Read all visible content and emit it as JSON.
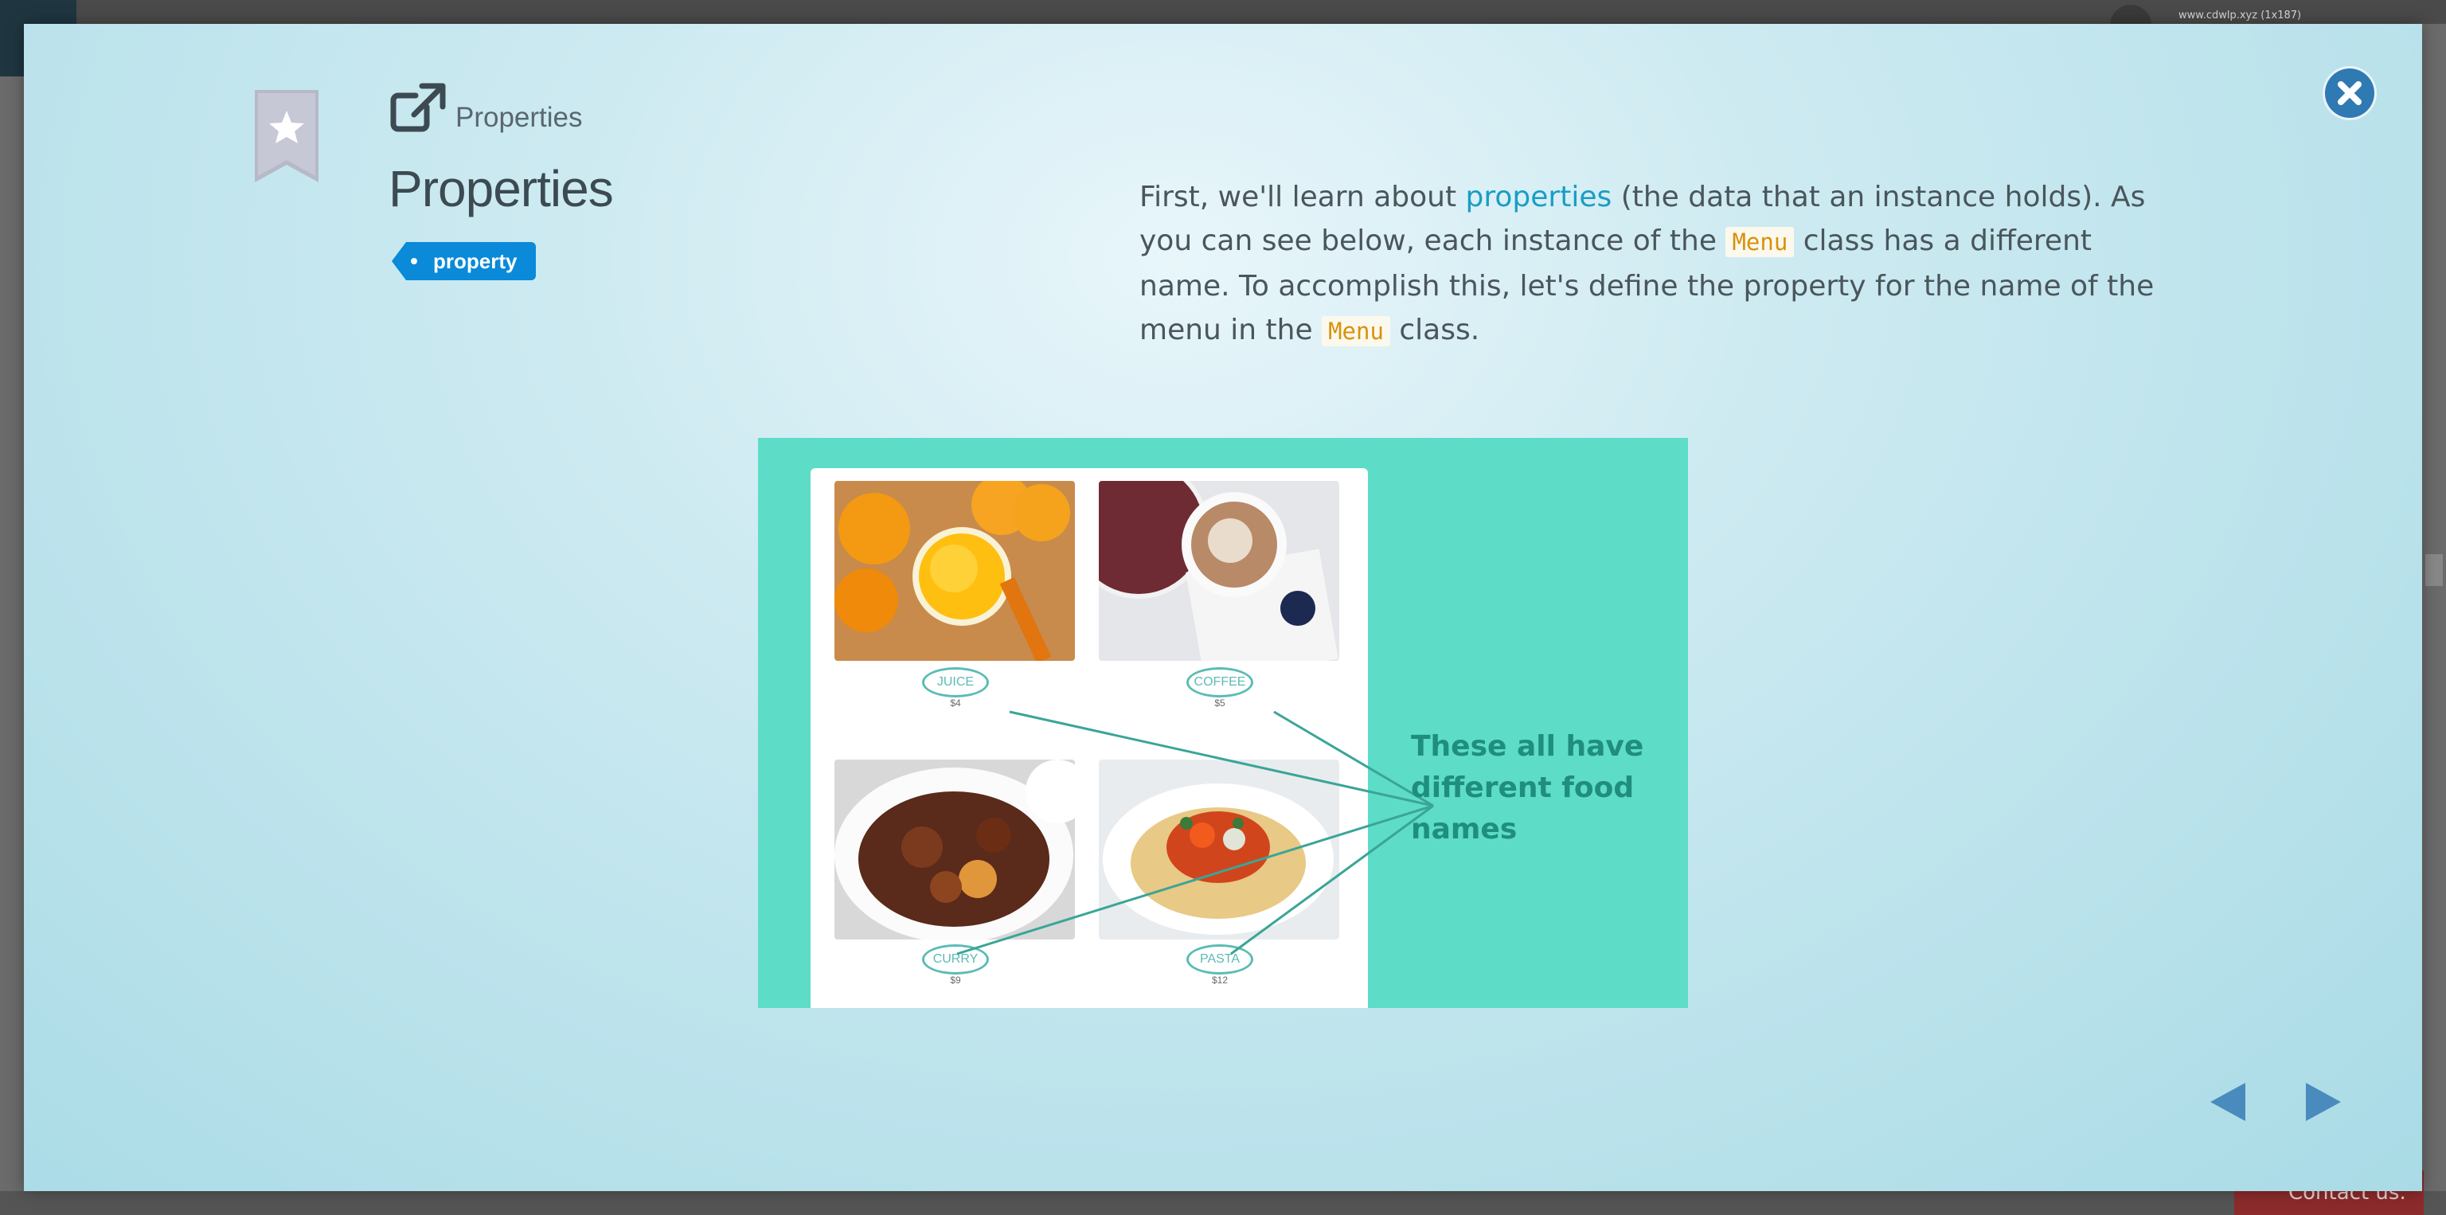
{
  "background": {
    "address_text": "www.cdwlp.xyz (1x187)",
    "contact_label": "Contact us."
  },
  "header": {
    "small_title": "Properties",
    "title": "Properties",
    "tag": "property"
  },
  "paragraph": {
    "part1": "First, we'll learn about ",
    "link": "properties",
    "part2": " (the data that an instance holds). As you can see below, each instance of the ",
    "code1": "Menu",
    "part3": " class has a different name. To accomplish this, let's define the property for the name of the menu in the ",
    "code2": "Menu",
    "part4": " class."
  },
  "figure": {
    "items": [
      {
        "name": "JUICE",
        "price": "$4"
      },
      {
        "name": "COFFEE",
        "price": "$5"
      },
      {
        "name": "CURRY",
        "price": "$9"
      },
      {
        "name": "PASTA",
        "price": "$12"
      }
    ],
    "caption": "These all have different food names"
  },
  "colors": {
    "accent": "#1a9dc4",
    "tag": "#0a8ad8",
    "close": "#2f7ab3",
    "figure_bg": "#5ddcc8",
    "code": "#d9920a"
  },
  "icons": {
    "bookmark": "bookmark-star-icon",
    "external": "external-link-icon",
    "close": "close-icon",
    "prev": "triangle-left-icon",
    "next": "triangle-right-icon"
  }
}
